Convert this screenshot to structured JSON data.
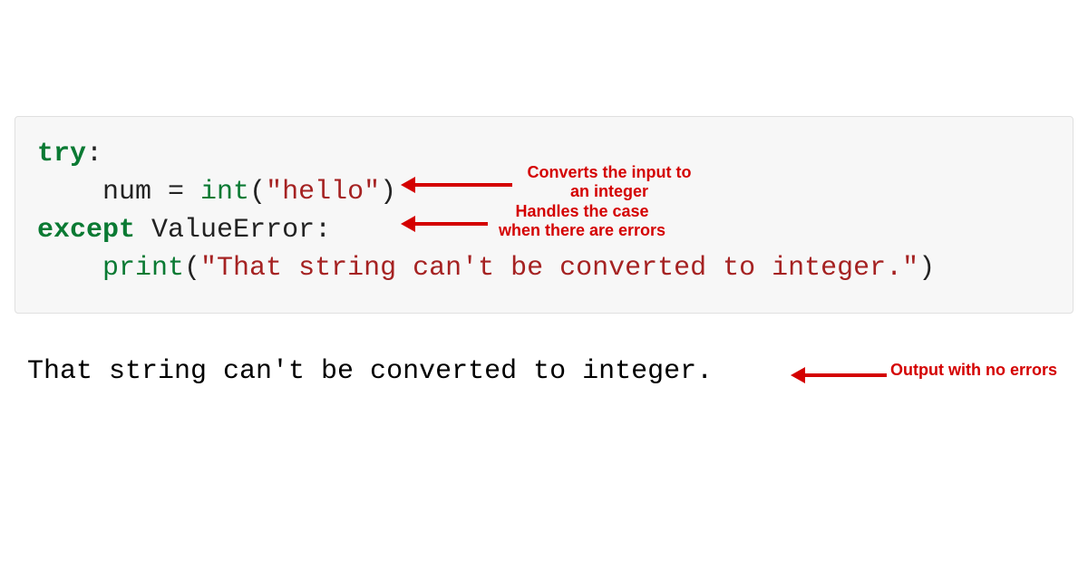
{
  "code": {
    "line1": {
      "try_kw": "try",
      "colon": ":"
    },
    "line2": {
      "indent": "    ",
      "num": "num",
      "eq": " = ",
      "int_fn": "int",
      "open": "(",
      "str": "\"hello\"",
      "close": ")"
    },
    "line3": {
      "except_kw": "except",
      "space": " ",
      "exc": "ValueError",
      "colon": ":"
    },
    "line4": {
      "indent": "    ",
      "print_fn": "print",
      "open": "(",
      "str": "\"That string can't be converted to integer.\"",
      "close": ")"
    }
  },
  "output": "That string can't be converted to integer.",
  "annotations": {
    "a1_line1": "Converts the input to",
    "a1_line2": "an integer",
    "a2_line1": "Handles the case",
    "a2_line2": "when there are errors",
    "a3": "Output with no errors"
  }
}
